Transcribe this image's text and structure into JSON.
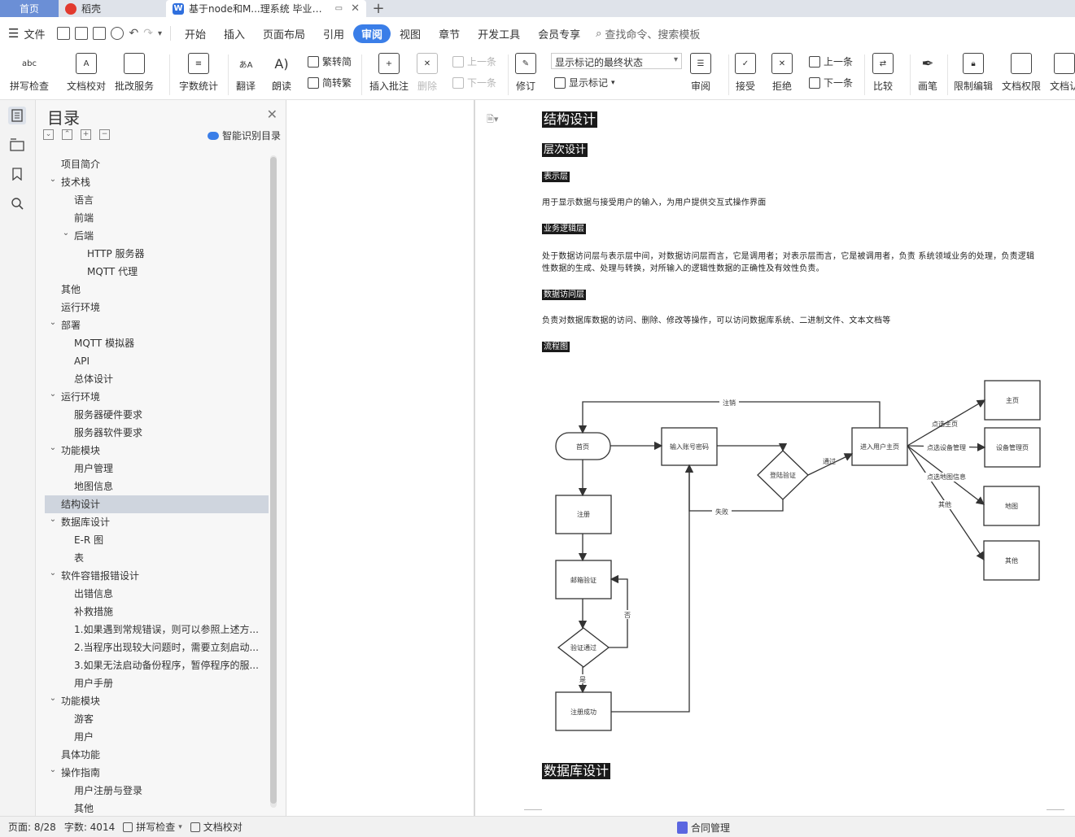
{
  "tabs": {
    "home": "首页",
    "daoke": "稻壳",
    "doc_title": "基于node和M...理系统 毕业论文",
    "new_tab": "+"
  },
  "menubar": {
    "file": "文件",
    "items": [
      "开始",
      "插入",
      "页面布局",
      "引用",
      "审阅",
      "视图",
      "章节",
      "开发工具",
      "会员专享"
    ],
    "active": "审阅",
    "search": "查找命令、搜索模板"
  },
  "ribbon": {
    "spell_check": "拼写检查",
    "doc_proof": "文档校对",
    "revision_service": "批改服务",
    "word_count": "字数统计",
    "translate": "翻译",
    "read_aloud": "朗读",
    "trad_to_simp": "繁转简",
    "simp_to_trad": "简转繁",
    "insert_comment": "插入批注",
    "delete": "删除",
    "prev_comment": "上一条",
    "next_comment": "下一条",
    "track_changes": "修订",
    "markup_state": "显示标记的最终状态",
    "show_markup": "显示标记",
    "review": "审阅",
    "accept": "接受",
    "reject": "拒绝",
    "prev_change": "上一条",
    "next_change": "下一条",
    "compare": "比较",
    "pen": "画笔",
    "restrict_edit": "限制编辑",
    "doc_permission": "文档权限",
    "doc_more": "文档认"
  },
  "toc": {
    "title": "目录",
    "smart": "智能识别目录",
    "items": [
      {
        "label": "项目简介",
        "level": 1,
        "arrow": false
      },
      {
        "label": "技术栈",
        "level": 1,
        "arrow": true
      },
      {
        "label": "语言",
        "level": 2,
        "arrow": false
      },
      {
        "label": "前端",
        "level": 2,
        "arrow": false
      },
      {
        "label": "后端",
        "level": 2,
        "arrow": true
      },
      {
        "label": "HTTP 服务器",
        "level": 3,
        "arrow": false
      },
      {
        "label": "MQTT 代理",
        "level": 3,
        "arrow": false
      },
      {
        "label": "其他",
        "level": 1,
        "arrow": false
      },
      {
        "label": "运行环境",
        "level": 1,
        "arrow": false
      },
      {
        "label": "部署",
        "level": 1,
        "arrow": true
      },
      {
        "label": "MQTT 模拟器",
        "level": 2,
        "arrow": false
      },
      {
        "label": "API",
        "level": 2,
        "arrow": false
      },
      {
        "label": "总体设计",
        "level": 2,
        "arrow": false
      },
      {
        "label": "运行环境",
        "level": 1,
        "arrow": true
      },
      {
        "label": "服务器硬件要求",
        "level": 2,
        "arrow": false
      },
      {
        "label": "服务器软件要求",
        "level": 2,
        "arrow": false
      },
      {
        "label": "功能模块",
        "level": 1,
        "arrow": true
      },
      {
        "label": "用户管理",
        "level": 2,
        "arrow": false
      },
      {
        "label": "地图信息",
        "level": 2,
        "arrow": false
      },
      {
        "label": "结构设计",
        "level": 1,
        "arrow": false,
        "selected": true
      },
      {
        "label": "数据库设计",
        "level": 1,
        "arrow": true
      },
      {
        "label": "E-R 图",
        "level": 2,
        "arrow": false
      },
      {
        "label": "表",
        "level": 2,
        "arrow": false
      },
      {
        "label": "软件容错报错设计",
        "level": 1,
        "arrow": true
      },
      {
        "label": "出错信息",
        "level": 2,
        "arrow": false
      },
      {
        "label": "补救措施",
        "level": 2,
        "arrow": false
      },
      {
        "label": "1.如果遇到常规错误，则可以参照上述方...",
        "level": 2,
        "arrow": false
      },
      {
        "label": "2.当程序出现较大问题时，需要立刻启动...",
        "level": 2,
        "arrow": false
      },
      {
        "label": "3.如果无法启动备份程序，暂停程序的服...",
        "level": 2,
        "arrow": false
      },
      {
        "label": "用户手册",
        "level": 2,
        "arrow": false
      },
      {
        "label": "功能模块",
        "level": 1,
        "arrow": true
      },
      {
        "label": "游客",
        "level": 2,
        "arrow": false
      },
      {
        "label": "用户",
        "level": 2,
        "arrow": false
      },
      {
        "label": "具体功能",
        "level": 1,
        "arrow": false
      },
      {
        "label": "操作指南",
        "level": 1,
        "arrow": true
      },
      {
        "label": "用户注册与登录",
        "level": 2,
        "arrow": false
      },
      {
        "label": "其他",
        "level": 2,
        "arrow": false
      }
    ]
  },
  "document": {
    "h_structure": "结构设计",
    "h_layer": "层次设计",
    "h_presentation": "表示层",
    "p_presentation": "用于显示数据与接受用户的输入，为用户提供交互式操作界面",
    "h_business": "业务逻辑层",
    "p_business": "处于数据访问层与表示层中间，对数据访问层而言，它是调用者；对表示层而言，它是被调用者，负责 系统领域业务的处理，负责逻辑性数据的生成、处理与转换，对所输入的逻辑性数据的正确性及有效性负责。",
    "h_dataaccess": "数据访问层",
    "p_dataaccess": "负责对数据库数据的访问、删除、修改等操作，可以访问数据库系统、二进制文件、文本文档等",
    "h_flowchart": "流程图",
    "h_database": "数据库设计"
  },
  "flowchart": {
    "home": "首页",
    "input": "输入账号密码",
    "login_verify": "登陆验证",
    "enter_home": "进入用户主页",
    "register": "注册",
    "email_verify": "邮箱验证",
    "verify_pass": "验证通过",
    "register_ok": "注册成功",
    "main_page": "主页",
    "device_page": "设备管理页",
    "map": "地图",
    "other": "其他",
    "e_logout": "注销",
    "e_pass": "通过",
    "e_fail": "失败",
    "e_no": "否",
    "e_yes": "是",
    "e_click_home": "点选主页",
    "e_click_device": "点选设备管理",
    "e_click_map": "点选地图信息",
    "e_other": "其他"
  },
  "statusbar": {
    "page": "页面: 8/28",
    "words": "字数: 4014",
    "spell": "拼写检查",
    "proof": "文档校对",
    "contract": "合同管理"
  },
  "colors": {
    "accent": "#3a7ee8",
    "home_tab": "#6b8fd6",
    "tab_bar": "#dfe3ea",
    "heading_bg": "#1a1a1a",
    "toc_selected": "#cfd5de"
  }
}
